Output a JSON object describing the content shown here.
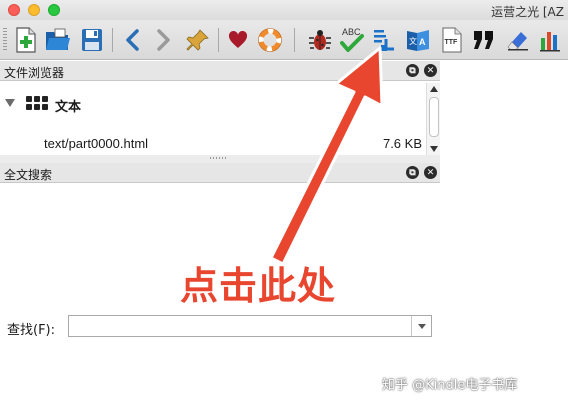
{
  "window": {
    "title": "运营之光 [AZ"
  },
  "toolbar": {
    "buttons": [
      {
        "icon": "add-file-icon"
      },
      {
        "icon": "open-folder-icon"
      },
      {
        "icon": "save-icon"
      },
      {
        "icon": "back-icon"
      },
      {
        "icon": "forward-icon"
      },
      {
        "icon": "pin-icon"
      },
      {
        "icon": "heart-icon"
      },
      {
        "icon": "lifebuoy-icon"
      },
      {
        "icon": "bug-icon"
      },
      {
        "icon": "spellcheck-icon"
      },
      {
        "icon": "toc-icon"
      },
      {
        "icon": "translate-icon"
      },
      {
        "icon": "ttf-font-icon"
      },
      {
        "icon": "quote-icon"
      },
      {
        "icon": "eraser-icon"
      },
      {
        "icon": "reports-icon"
      }
    ],
    "spellcheck_text": "ABC",
    "ttf_text": "TTF"
  },
  "file_browser": {
    "title": "文件浏览器",
    "group_label": "文本",
    "file_name": "text/part0000.html",
    "file_size": "7.6 KB"
  },
  "fulltext_search": {
    "title": "全文搜索",
    "find_label": "查找(F):",
    "find_value": ""
  },
  "annotation": {
    "text": "点击此处",
    "color": "#e8462f"
  },
  "watermark": "知乎 @Kindle电子书库",
  "colors": {
    "accent_blue": "#1a73c9",
    "arrow_red": "#e8462f"
  }
}
